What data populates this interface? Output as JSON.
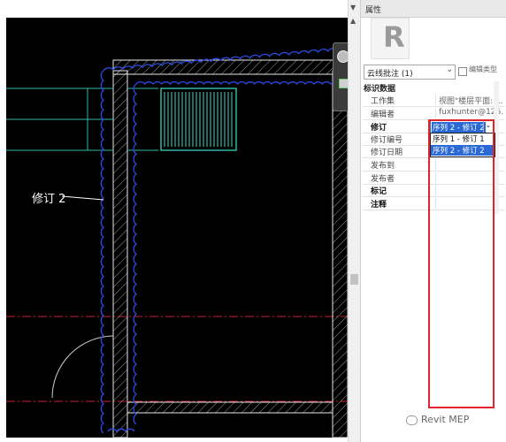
{
  "canvas": {
    "annotation_label": "修订 2"
  },
  "properties_panel": {
    "title": "属性",
    "family_icon_letter": "R",
    "type_selector": {
      "value": "云线批注 (1)",
      "edit_type_label": "编辑类型"
    },
    "group_header": "标识数据",
    "rows": [
      {
        "label": "工作集",
        "value": "视图\"楼层平面: ..."
      },
      {
        "label": "编辑者",
        "value": "fuxhunter@126..."
      },
      {
        "label": "修订",
        "value": ""
      },
      {
        "label": "修订编号",
        "value": ""
      },
      {
        "label": "修订日期",
        "value": ""
      },
      {
        "label": "发布到",
        "value": ""
      },
      {
        "label": "发布者",
        "value": ""
      },
      {
        "label": "标记",
        "value": ""
      },
      {
        "label": "注释",
        "value": ""
      }
    ],
    "revision_dropdown": {
      "selected": "序列 2 - 修订 2",
      "options": [
        "序列 1 - 修订 1",
        "序列 2 - 修订 2"
      ]
    },
    "highlight_color": "#e0242c"
  },
  "watermark": "Revit MEP",
  "colors": {
    "canvas_background": "#000000",
    "revision_cloud": "#2a4be0",
    "wall_line": "#ffffff",
    "duct": "#2fb8a8",
    "reference_line": "#c8202a",
    "selection": "#2b6ad6"
  }
}
